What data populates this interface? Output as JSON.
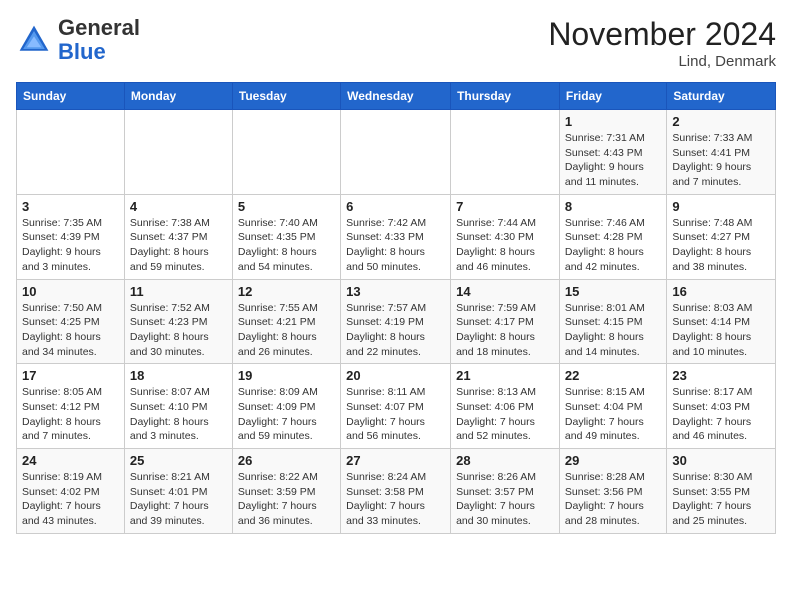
{
  "header": {
    "logo_line1": "General",
    "logo_line2": "Blue",
    "month": "November 2024",
    "location": "Lind, Denmark"
  },
  "weekdays": [
    "Sunday",
    "Monday",
    "Tuesday",
    "Wednesday",
    "Thursday",
    "Friday",
    "Saturday"
  ],
  "weeks": [
    [
      {
        "day": "",
        "info": ""
      },
      {
        "day": "",
        "info": ""
      },
      {
        "day": "",
        "info": ""
      },
      {
        "day": "",
        "info": ""
      },
      {
        "day": "",
        "info": ""
      },
      {
        "day": "1",
        "info": "Sunrise: 7:31 AM\nSunset: 4:43 PM\nDaylight: 9 hours and 11 minutes."
      },
      {
        "day": "2",
        "info": "Sunrise: 7:33 AM\nSunset: 4:41 PM\nDaylight: 9 hours and 7 minutes."
      }
    ],
    [
      {
        "day": "3",
        "info": "Sunrise: 7:35 AM\nSunset: 4:39 PM\nDaylight: 9 hours and 3 minutes."
      },
      {
        "day": "4",
        "info": "Sunrise: 7:38 AM\nSunset: 4:37 PM\nDaylight: 8 hours and 59 minutes."
      },
      {
        "day": "5",
        "info": "Sunrise: 7:40 AM\nSunset: 4:35 PM\nDaylight: 8 hours and 54 minutes."
      },
      {
        "day": "6",
        "info": "Sunrise: 7:42 AM\nSunset: 4:33 PM\nDaylight: 8 hours and 50 minutes."
      },
      {
        "day": "7",
        "info": "Sunrise: 7:44 AM\nSunset: 4:30 PM\nDaylight: 8 hours and 46 minutes."
      },
      {
        "day": "8",
        "info": "Sunrise: 7:46 AM\nSunset: 4:28 PM\nDaylight: 8 hours and 42 minutes."
      },
      {
        "day": "9",
        "info": "Sunrise: 7:48 AM\nSunset: 4:27 PM\nDaylight: 8 hours and 38 minutes."
      }
    ],
    [
      {
        "day": "10",
        "info": "Sunrise: 7:50 AM\nSunset: 4:25 PM\nDaylight: 8 hours and 34 minutes."
      },
      {
        "day": "11",
        "info": "Sunrise: 7:52 AM\nSunset: 4:23 PM\nDaylight: 8 hours and 30 minutes."
      },
      {
        "day": "12",
        "info": "Sunrise: 7:55 AM\nSunset: 4:21 PM\nDaylight: 8 hours and 26 minutes."
      },
      {
        "day": "13",
        "info": "Sunrise: 7:57 AM\nSunset: 4:19 PM\nDaylight: 8 hours and 22 minutes."
      },
      {
        "day": "14",
        "info": "Sunrise: 7:59 AM\nSunset: 4:17 PM\nDaylight: 8 hours and 18 minutes."
      },
      {
        "day": "15",
        "info": "Sunrise: 8:01 AM\nSunset: 4:15 PM\nDaylight: 8 hours and 14 minutes."
      },
      {
        "day": "16",
        "info": "Sunrise: 8:03 AM\nSunset: 4:14 PM\nDaylight: 8 hours and 10 minutes."
      }
    ],
    [
      {
        "day": "17",
        "info": "Sunrise: 8:05 AM\nSunset: 4:12 PM\nDaylight: 8 hours and 7 minutes."
      },
      {
        "day": "18",
        "info": "Sunrise: 8:07 AM\nSunset: 4:10 PM\nDaylight: 8 hours and 3 minutes."
      },
      {
        "day": "19",
        "info": "Sunrise: 8:09 AM\nSunset: 4:09 PM\nDaylight: 7 hours and 59 minutes."
      },
      {
        "day": "20",
        "info": "Sunrise: 8:11 AM\nSunset: 4:07 PM\nDaylight: 7 hours and 56 minutes."
      },
      {
        "day": "21",
        "info": "Sunrise: 8:13 AM\nSunset: 4:06 PM\nDaylight: 7 hours and 52 minutes."
      },
      {
        "day": "22",
        "info": "Sunrise: 8:15 AM\nSunset: 4:04 PM\nDaylight: 7 hours and 49 minutes."
      },
      {
        "day": "23",
        "info": "Sunrise: 8:17 AM\nSunset: 4:03 PM\nDaylight: 7 hours and 46 minutes."
      }
    ],
    [
      {
        "day": "24",
        "info": "Sunrise: 8:19 AM\nSunset: 4:02 PM\nDaylight: 7 hours and 43 minutes."
      },
      {
        "day": "25",
        "info": "Sunrise: 8:21 AM\nSunset: 4:01 PM\nDaylight: 7 hours and 39 minutes."
      },
      {
        "day": "26",
        "info": "Sunrise: 8:22 AM\nSunset: 3:59 PM\nDaylight: 7 hours and 36 minutes."
      },
      {
        "day": "27",
        "info": "Sunrise: 8:24 AM\nSunset: 3:58 PM\nDaylight: 7 hours and 33 minutes."
      },
      {
        "day": "28",
        "info": "Sunrise: 8:26 AM\nSunset: 3:57 PM\nDaylight: 7 hours and 30 minutes."
      },
      {
        "day": "29",
        "info": "Sunrise: 8:28 AM\nSunset: 3:56 PM\nDaylight: 7 hours and 28 minutes."
      },
      {
        "day": "30",
        "info": "Sunrise: 8:30 AM\nSunset: 3:55 PM\nDaylight: 7 hours and 25 minutes."
      }
    ]
  ]
}
